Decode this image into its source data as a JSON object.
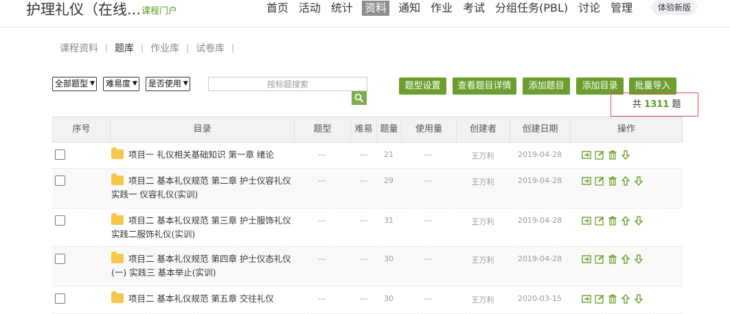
{
  "header": {
    "title": "护理礼仪（在线...",
    "portal_link": "课程门户",
    "nav": [
      "首页",
      "活动",
      "统计",
      "资料",
      "通知",
      "作业",
      "考试",
      "分组任务(PBL)",
      "讨论",
      "管理"
    ],
    "active_nav": "资料",
    "new_version": "体验新版"
  },
  "subnav": {
    "tabs": [
      "课程资料",
      "题库",
      "作业库",
      "试卷库"
    ],
    "active": "题库"
  },
  "filters": {
    "type": "全部题型",
    "difficulty": "难易度",
    "usage": "是否使用",
    "search_placeholder": "按标题搜索"
  },
  "actions": {
    "type_settings": "题型设置",
    "view_details": "查看题目详情",
    "add_question": "添加题目",
    "add_directory": "添加目录",
    "batch_import": "批量导入"
  },
  "count": {
    "prefix": "共",
    "value": "1311",
    "suffix": "题"
  },
  "table": {
    "headers": [
      "序号",
      "目录",
      "题型",
      "难易",
      "题量",
      "使用量",
      "创建者",
      "创建日期",
      "操作"
    ],
    "rows": [
      {
        "dir": "项目一 礼仪相关基础知识 第一章 绪论",
        "type": "---",
        "difficulty": "---",
        "count": "21",
        "usage": "---",
        "creator": "王万利",
        "date": "2019-04-28"
      },
      {
        "dir": "项目二 基本礼仪规范 第二章 护士仪容礼仪 实践一 仪容礼仪(实训)",
        "type": "---",
        "difficulty": "---",
        "count": "29",
        "usage": "---",
        "creator": "王万利",
        "date": "2019-04-28"
      },
      {
        "dir": "项目二 基本礼仪规范 第三章 护士服饰礼仪 实践二服饰礼仪(实训)",
        "type": "---",
        "difficulty": "---",
        "count": "31",
        "usage": "---",
        "creator": "王万利",
        "date": "2019-04-28"
      },
      {
        "dir": "项目二 基本礼仪规范 第四章 护士仪态礼仪(一) 实践三 基本举止(实训)",
        "type": "---",
        "difficulty": "---",
        "count": "30",
        "usage": "---",
        "creator": "王万利",
        "date": "2019-04-28"
      },
      {
        "dir": "项目二 基本礼仪规范 第五章 交往礼仪",
        "type": "---",
        "difficulty": "---",
        "count": "30",
        "usage": "---",
        "creator": "王万利",
        "date": "2020-03-15"
      }
    ]
  },
  "colors": {
    "accent": "#6b9e2e",
    "link": "#5a9a25",
    "highlight_border": "#e05050"
  }
}
